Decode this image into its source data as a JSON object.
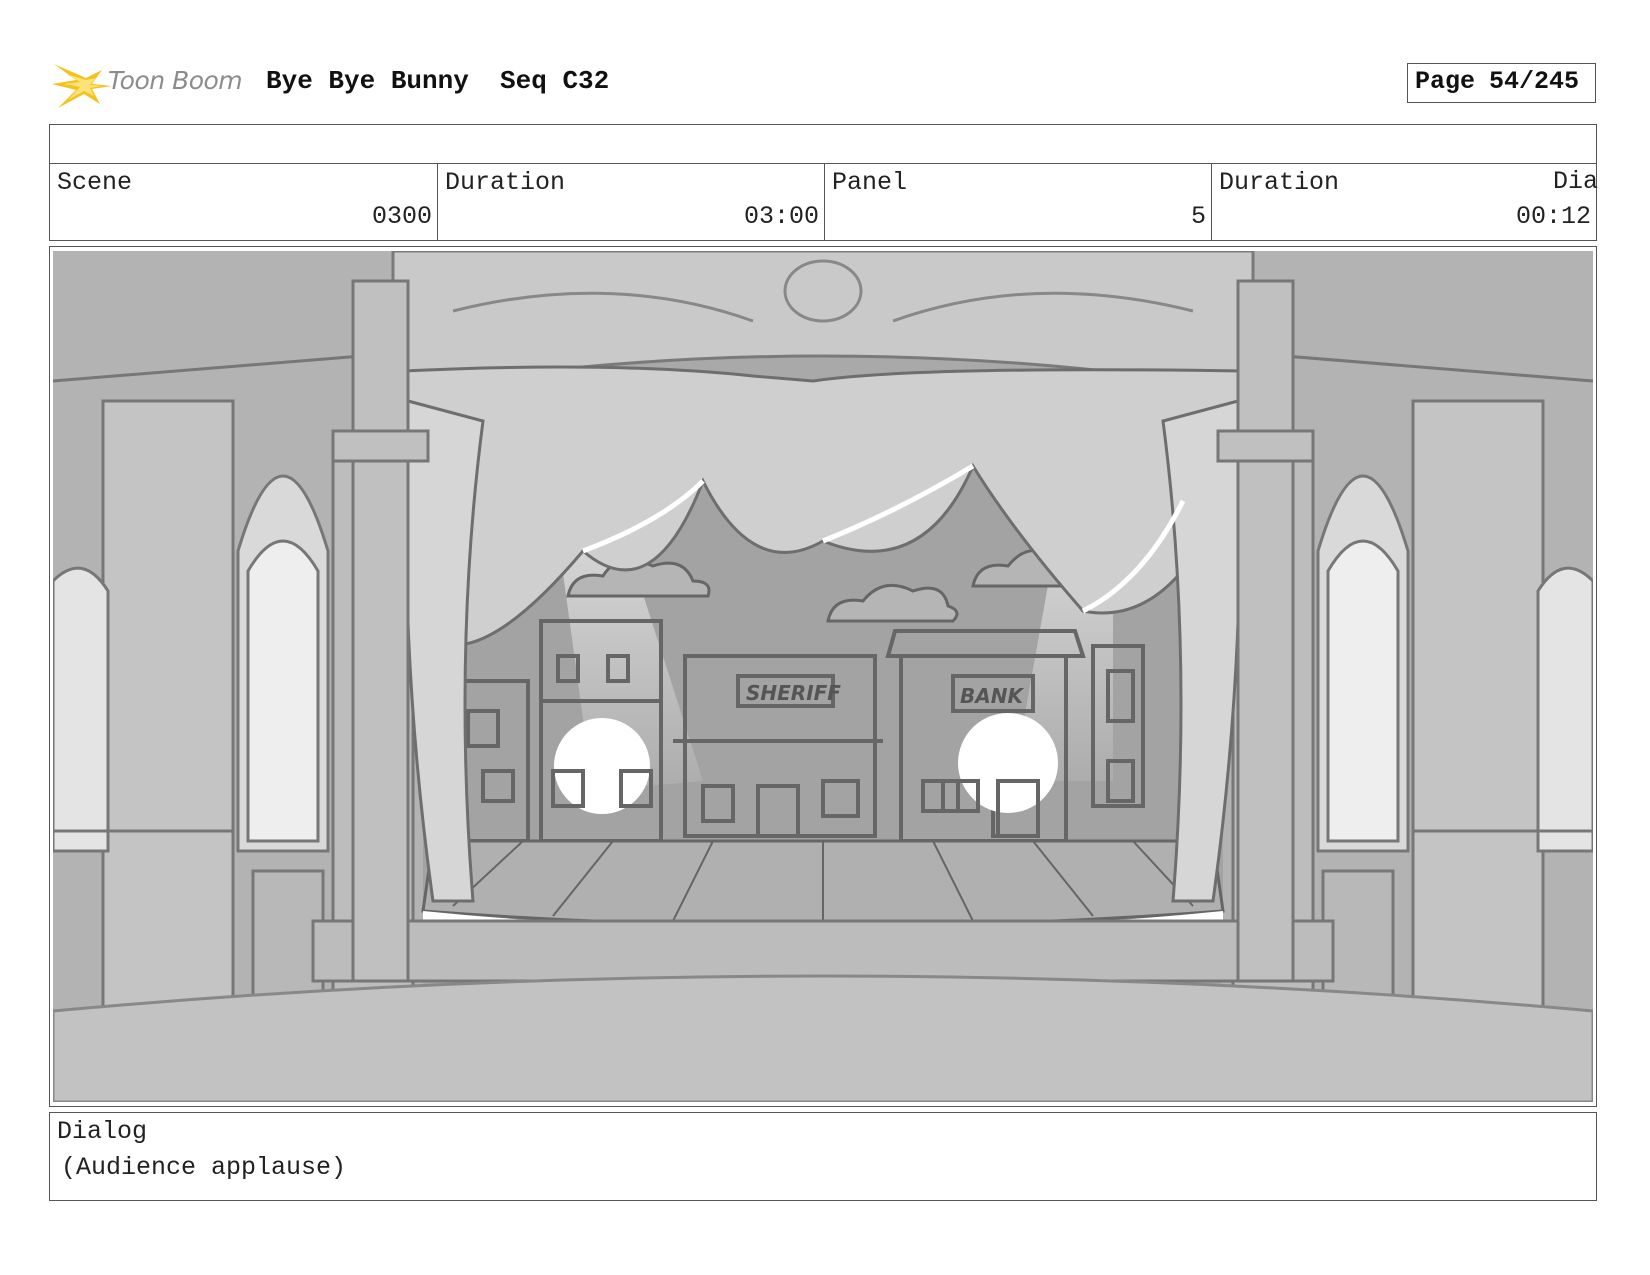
{
  "header": {
    "logo_text": "Toon Boom",
    "title": "Bye Bye Bunny  Seq C32",
    "page_label": "Page",
    "page_value": "54/245"
  },
  "info": {
    "scene_label": "Scene",
    "scene_value": "0300",
    "scene_duration_label": "Duration",
    "scene_duration_value": "03:00",
    "panel_label": "Panel",
    "panel_value": "5",
    "panel_duration_label": "Duration",
    "panel_duration_value": "00:12",
    "overflow_label": "Dia"
  },
  "panel": {
    "sign_sheriff": "SHERIFF",
    "sign_bank": "BANK"
  },
  "dialog": {
    "label": "Dialog",
    "text": "(Audience applause)"
  },
  "colors": {
    "logo_accent": "#f5c21b",
    "border": "#555555",
    "sketch_gray": "#a6a6a6"
  }
}
